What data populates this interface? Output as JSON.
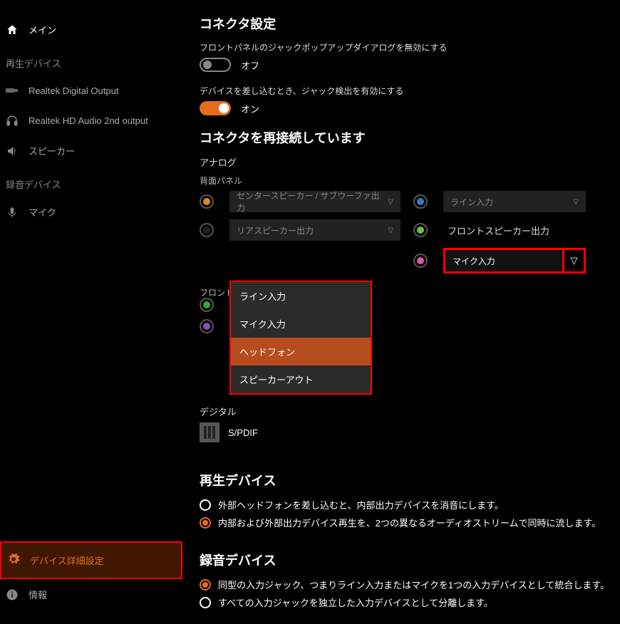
{
  "sidebar": {
    "main": "メイン",
    "playback_section": "再生デバイス",
    "playback": [
      "Realtek Digital Output",
      "Realtek HD Audio 2nd output",
      "スピーカー"
    ],
    "record_section": "録音デバイス",
    "record": [
      "マイク"
    ],
    "advanced": "デバイス詳細設定",
    "info": "情報"
  },
  "connector": {
    "heading": "コネクタ設定",
    "opt1_label": "フロントパネルのジャックポップアップダイアログを無効にする",
    "opt1_state": "オフ",
    "opt2_label": "デバイスを差し込むとき、ジャック検出を有効にする",
    "opt2_state": "オン"
  },
  "reconnect": {
    "heading": "コネクタを再接続しています",
    "analog": "アナログ",
    "rear_panel": "背面パネル",
    "sel_center": "センタースピーカー / サブウーファ出力",
    "sel_rear": "リアスピーカー出力",
    "label_line_in": "ライン入力",
    "label_front_speaker": "フロントスピーカー出力",
    "label_mic_in": "マイク入力",
    "dropdown": [
      "ライン入力",
      "マイク入力",
      "ヘッドフォン",
      "スピーカーアウト"
    ],
    "front_panel": "フロントパネル",
    "digital": "デジタル",
    "spdif": "S/PDIF"
  },
  "playback": {
    "heading": "再生デバイス",
    "opt1": "外部ヘッドフォンを差し込むと、内部出力デバイスを消音にします。",
    "opt2": "内部および外部出力デバイス再生を、2つの異なるオーディオストリームで同時に流します。"
  },
  "recording": {
    "heading": "録音デバイス",
    "opt1": "同型の入力ジャック、つまりライン入力またはマイクを1つの入力デバイスとして統合します。",
    "opt2": "すべての入力ジャックを独立した入力デバイスとして分離します。"
  },
  "colors": {
    "orange": "#d88a2a",
    "black": "#333",
    "blue": "#3a7abf",
    "lime": "#6bbf3a",
    "pink": "#d85ab0",
    "green": "#2fa82f",
    "purple": "#8a4fbf"
  }
}
